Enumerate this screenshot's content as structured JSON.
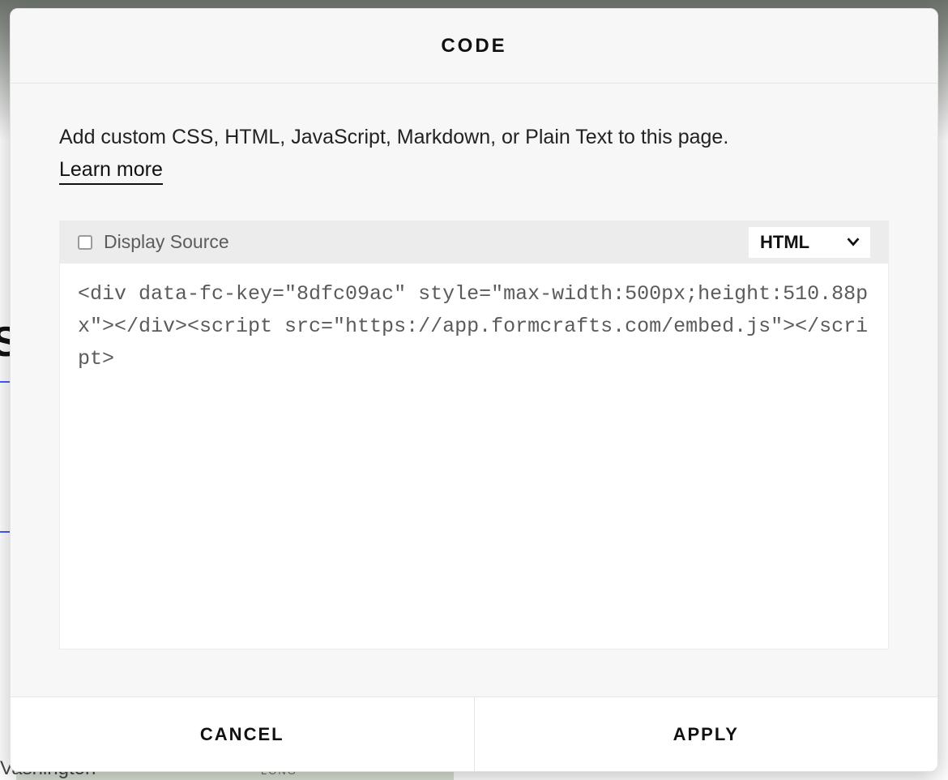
{
  "background": {
    "partial_heading": "S",
    "bottom_left_text": "Vashington",
    "map_label": "LONG"
  },
  "modal": {
    "title": "CODE",
    "intro": "Add custom CSS, HTML, JavaScript, Markdown, or Plain Text to this page.",
    "learn_more_label": "Learn more",
    "toolbar": {
      "display_source_label": "Display Source",
      "display_source_checked": false,
      "type_selected": "HTML"
    },
    "code": "<div data-fc-key=\"8dfc09ac\" style=\"max-width:500px;height:510.88px\"></div><script src=\"https://app.formcrafts.com/embed.js\"></script>",
    "footer": {
      "cancel_label": "CANCEL",
      "apply_label": "APPLY"
    }
  }
}
